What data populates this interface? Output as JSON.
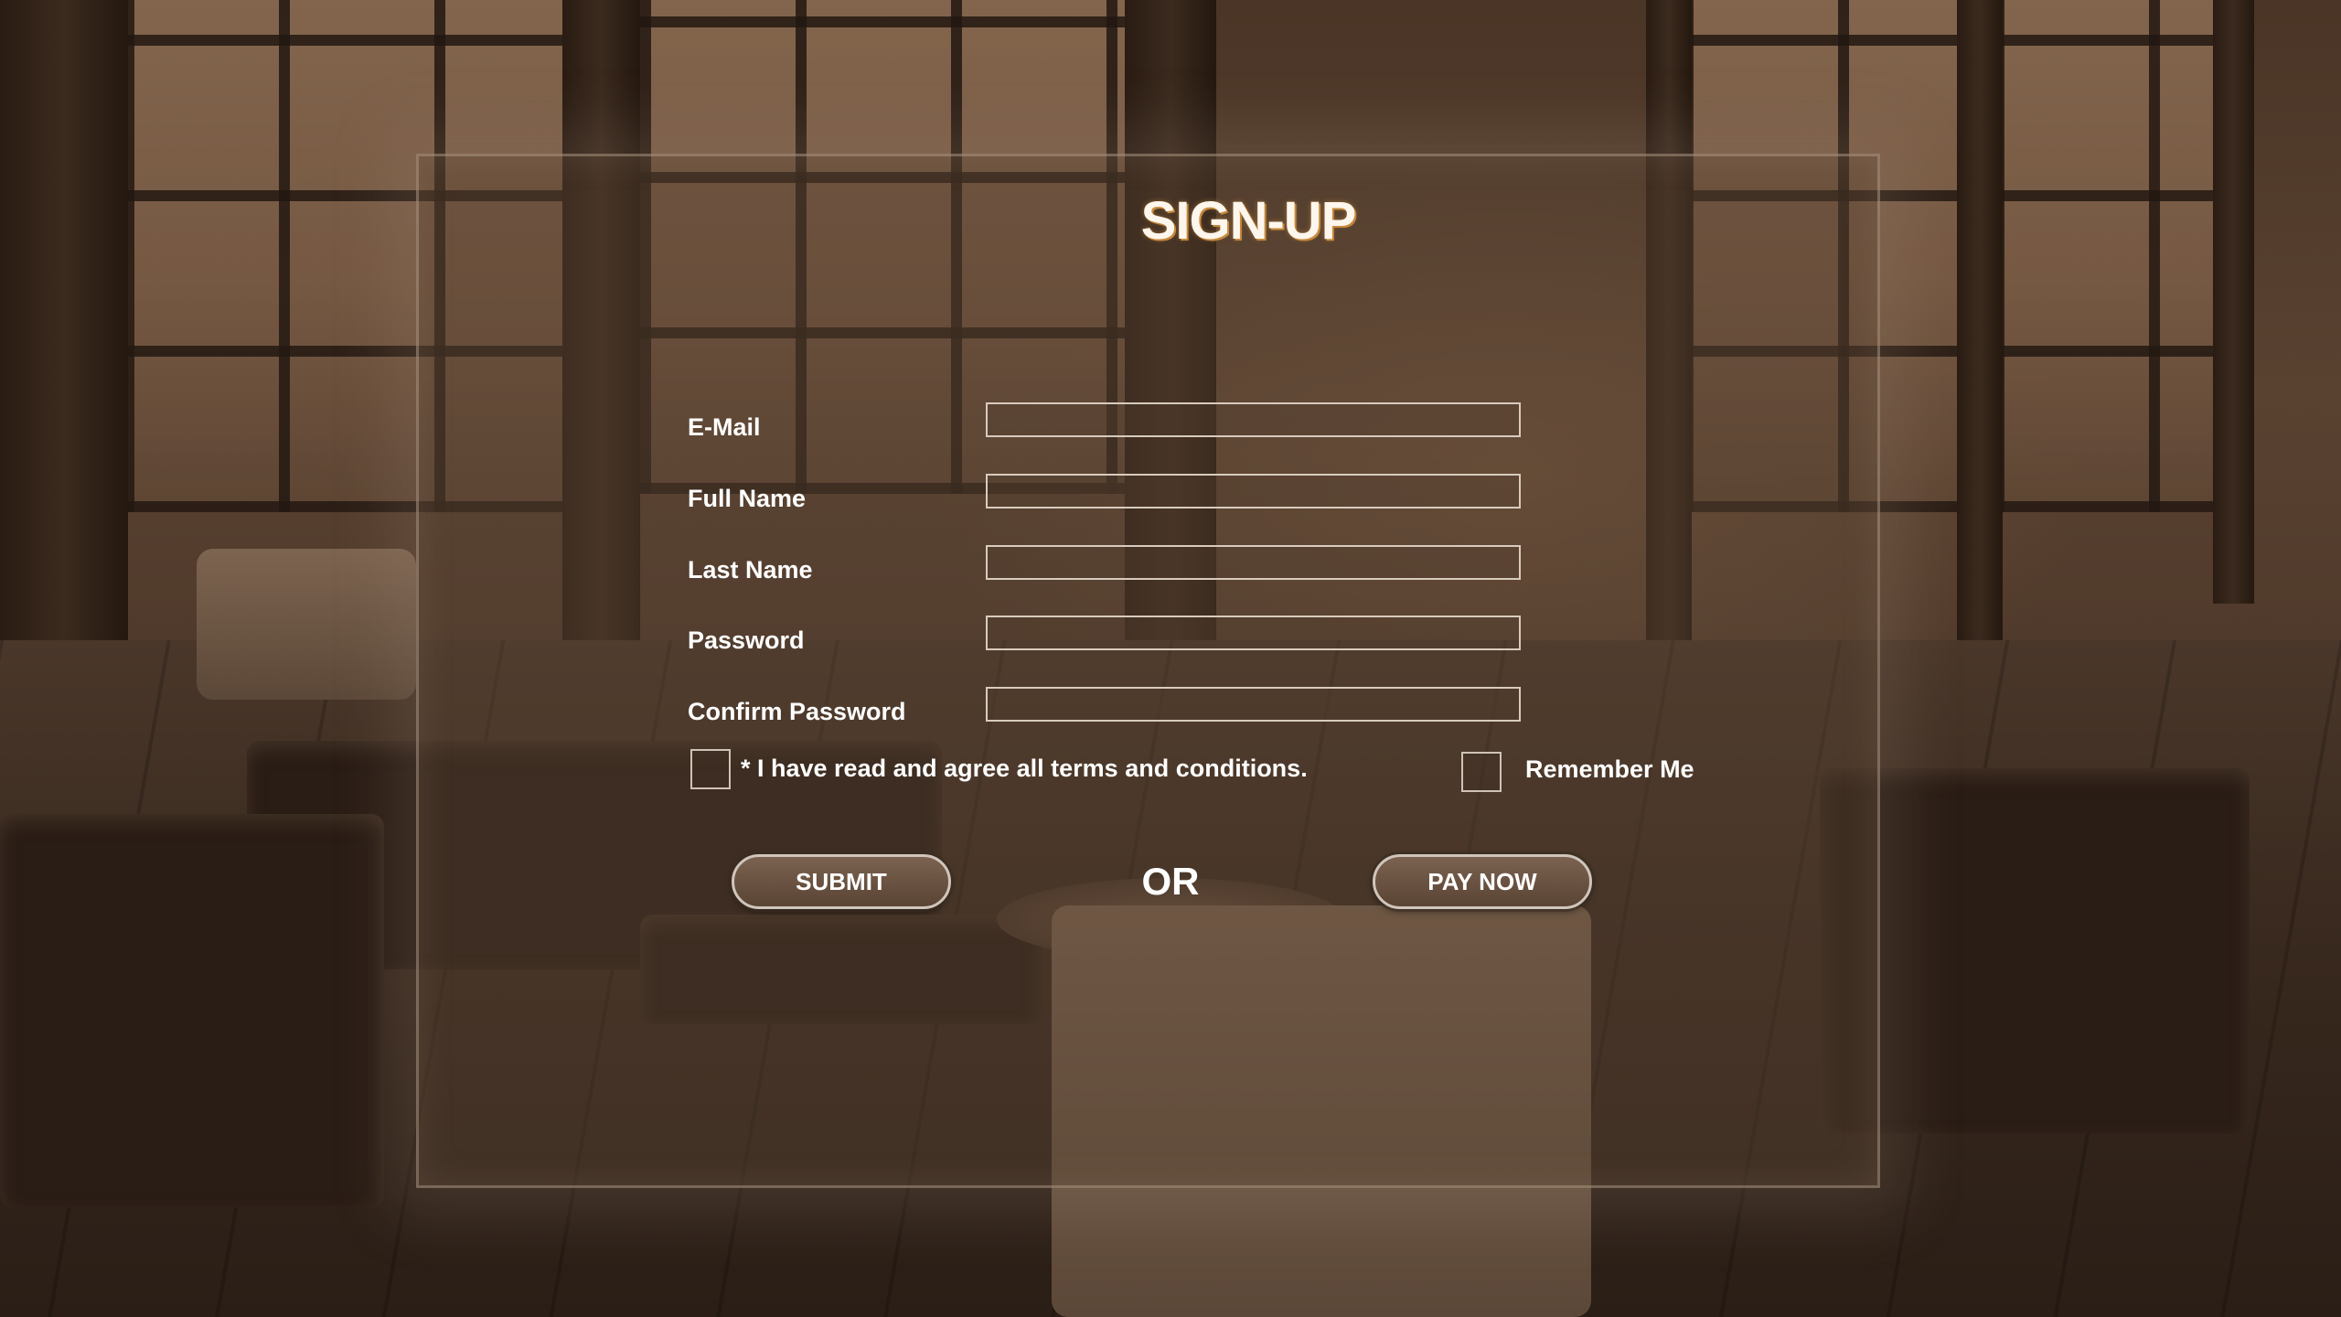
{
  "form": {
    "title": "SIGN-UP",
    "fields": [
      {
        "label": "E-Mail",
        "value": ""
      },
      {
        "label": "Full Name",
        "value": ""
      },
      {
        "label": "Last Name",
        "value": ""
      },
      {
        "label": "Password",
        "value": ""
      },
      {
        "label": "Confirm Password",
        "value": ""
      }
    ],
    "terms_label": "* I have read and agree all terms and conditions.",
    "remember_label": "Remember Me",
    "submit_label": "SUBMIT",
    "or_label": "OR",
    "pay_label": "PAY NOW"
  },
  "theme": {
    "accent": "#c78a3c",
    "panel_border": "#d8cbbd",
    "text": "#ffffff"
  }
}
